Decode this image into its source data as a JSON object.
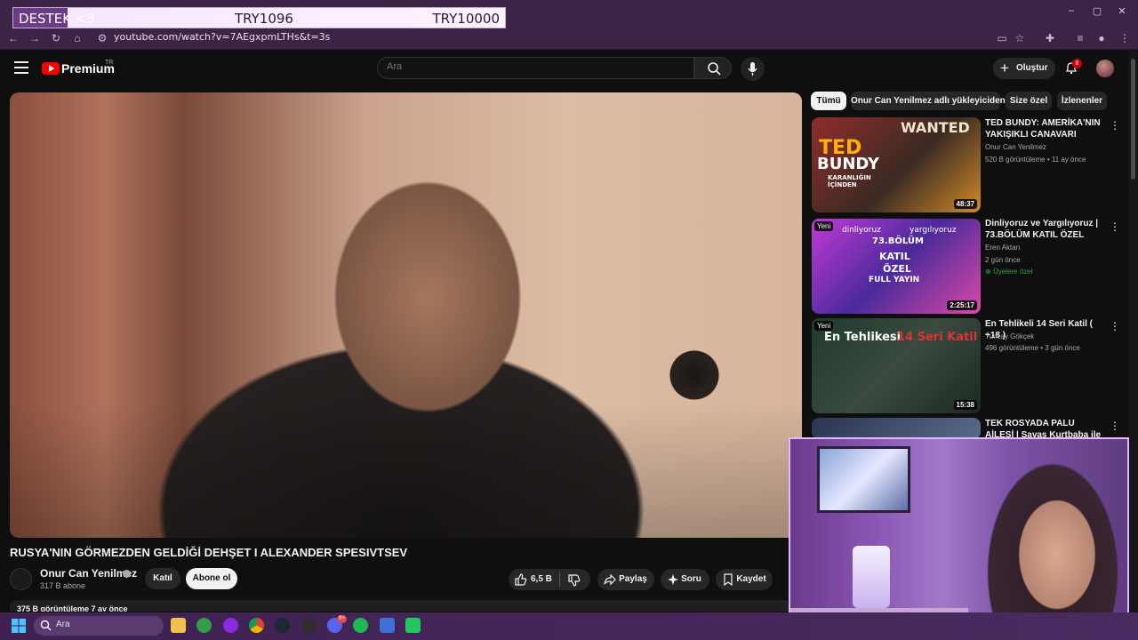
{
  "browser": {
    "url": "youtube.com/watch?v=7AEgxpmLTHs&t=3s"
  },
  "donation": {
    "label": "DESTEK <3",
    "current": "TRY1096",
    "goal": "TRY10000",
    "progress_fraction": 0.11
  },
  "header": {
    "logo_text": "Premium",
    "region": "TR",
    "search_placeholder": "Ara",
    "create_label": "Oluştur",
    "notification_count": "8"
  },
  "video": {
    "title": "RUSYA'NIN GÖRMEZDEN GELDİĞİ DEHŞET I ALEXANDER SPESIVTSEV",
    "channel": "Onur Can Yenilmez",
    "subscribers": "317 B abone",
    "join_label": "Katıl",
    "subscribe_label": "Abone ol",
    "likes": "6,5 B",
    "share_label": "Paylaş",
    "ask_label": "Soru",
    "save_label": "Kaydet",
    "views_line": "375 B görüntüleme  7 ay önce"
  },
  "chips": [
    "Tümü",
    "Onur Can Yenilmez adlı yükleyiciden",
    "Size özel",
    "İzlenenler"
  ],
  "recommendations": [
    {
      "title": "TED BUNDY: AMERİKA'NIN YAKIŞIKLI CANAVARI",
      "channel": "Onur Can Yenilmez",
      "meta": "520 B görüntüleme • 11 ay önce",
      "duration": "48:37",
      "thumb_text": [
        "TED",
        "BUNDY",
        "KARANLIĞIN İÇİNDEN",
        "WANTED"
      ]
    },
    {
      "title": "Dinliyoruz ve Yargılıyoruz | 73.BÖLÜM KATIL ÖZEL",
      "channel": "Eren Aktan",
      "meta": "2 gün önce",
      "badge": "Üyelere özel",
      "duration": "2:25:17",
      "new_label": "Yeni",
      "thumb_text": [
        "dinliyoruz",
        "yargılıyoruz",
        "73.BÖLÜM",
        "KATIL",
        "ÖZEL",
        "FULL YAYIN"
      ]
    },
    {
      "title": "En Tehlikeli 14 Seri Katil ( +18 )",
      "channel": "Tuncay Gökçek",
      "meta": "496 görüntüleme • 3 gün önce",
      "duration": "15:38",
      "new_label": "Yeni",
      "thumb_text": [
        "En Tehlikesi",
        "14 Seri Katil"
      ]
    },
    {
      "title": "TEK ROSYADA PALU AİLESİ | Savaş Kurtbaba ile Suçun ..."
    }
  ],
  "taskbar": {
    "search_label": "Ara",
    "discord_badge": "9+"
  },
  "colors": {
    "youtube_red": "#ff0000",
    "overlay_purple": "#e3b7ff",
    "chrome_purple": "#3b2446"
  }
}
